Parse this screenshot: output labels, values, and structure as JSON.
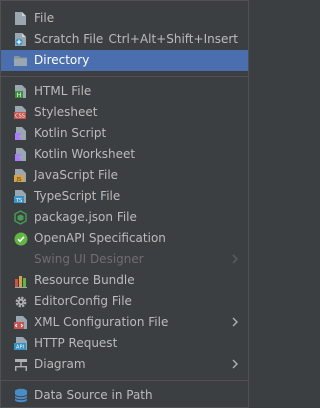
{
  "menu": {
    "items": [
      {
        "label": "File",
        "icon": "file-icon"
      },
      {
        "label": "Scratch File",
        "icon": "scratch-file-icon",
        "shortcut": "Ctrl+Alt+Shift+Insert"
      },
      {
        "label": "Directory",
        "icon": "folder-icon",
        "selected": true
      },
      {
        "label": "HTML File",
        "icon": "html-file-icon"
      },
      {
        "label": "Stylesheet",
        "icon": "css-file-icon"
      },
      {
        "label": "Kotlin Script",
        "icon": "kotlin-script-icon"
      },
      {
        "label": "Kotlin Worksheet",
        "icon": "kotlin-worksheet-icon"
      },
      {
        "label": "JavaScript File",
        "icon": "javascript-file-icon"
      },
      {
        "label": "TypeScript File",
        "icon": "typescript-file-icon"
      },
      {
        "label": "package.json File",
        "icon": "package-json-icon"
      },
      {
        "label": "OpenAPI Specification",
        "icon": "openapi-icon"
      },
      {
        "label": "Swing UI Designer",
        "disabled": true
      },
      {
        "label": "Resource Bundle",
        "icon": "resource-bundle-icon"
      },
      {
        "label": "EditorConfig File",
        "icon": "editorconfig-gear-icon"
      },
      {
        "label": "XML Configuration File",
        "icon": "xml-file-icon"
      },
      {
        "label": "HTTP Request",
        "icon": "http-request-icon"
      },
      {
        "label": "Diagram",
        "icon": "diagram-icon"
      },
      {
        "label": "Data Source in Path",
        "icon": "database-icon"
      }
    ]
  },
  "colors": {
    "background": "#3c3f41",
    "selection": "#4b6eaf",
    "text": "#bbbbbb",
    "disabled_text": "#6d6e70"
  }
}
